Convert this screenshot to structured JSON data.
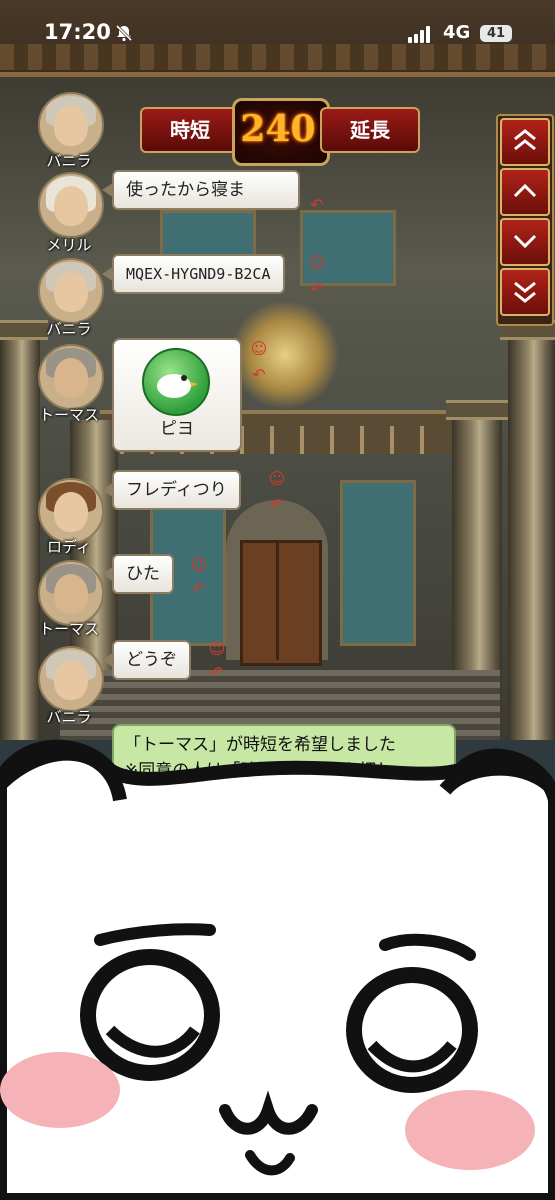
{
  "status_bar": {
    "time": "17:20",
    "network": "4G",
    "battery": "41"
  },
  "timer": {
    "shorten_label": "時短",
    "value": "240",
    "extend_label": "延長"
  },
  "messages": [
    {
      "speaker": "バニラ",
      "text": ""
    },
    {
      "speaker": "メリル",
      "text": "使ったから寝ま"
    },
    {
      "speaker": "バニラ",
      "text": "MQEX-HYGND9-B2CA"
    },
    {
      "speaker": "トーマス",
      "stamp": "ピヨ"
    },
    {
      "speaker": "ロディ",
      "text": "フレディつり"
    },
    {
      "speaker": "トーマス",
      "text": "ひた"
    },
    {
      "speaker": "バニラ",
      "text": "どうぞ"
    }
  ],
  "system_message": {
    "line1": "「トーマス」が時短を希望しました",
    "line2": "※同意の人は「時短」ボタンを押し"
  },
  "colors": {
    "accent_red": "#9b1b16",
    "gold": "#c8a45c",
    "system_green": "#c6e8a4"
  },
  "icons": [
    "mute-bell-icon",
    "signal-icon",
    "scroll-top-icon",
    "scroll-up-icon",
    "scroll-down-icon",
    "scroll-bottom-icon",
    "reaction-icon",
    "reply-icon"
  ]
}
